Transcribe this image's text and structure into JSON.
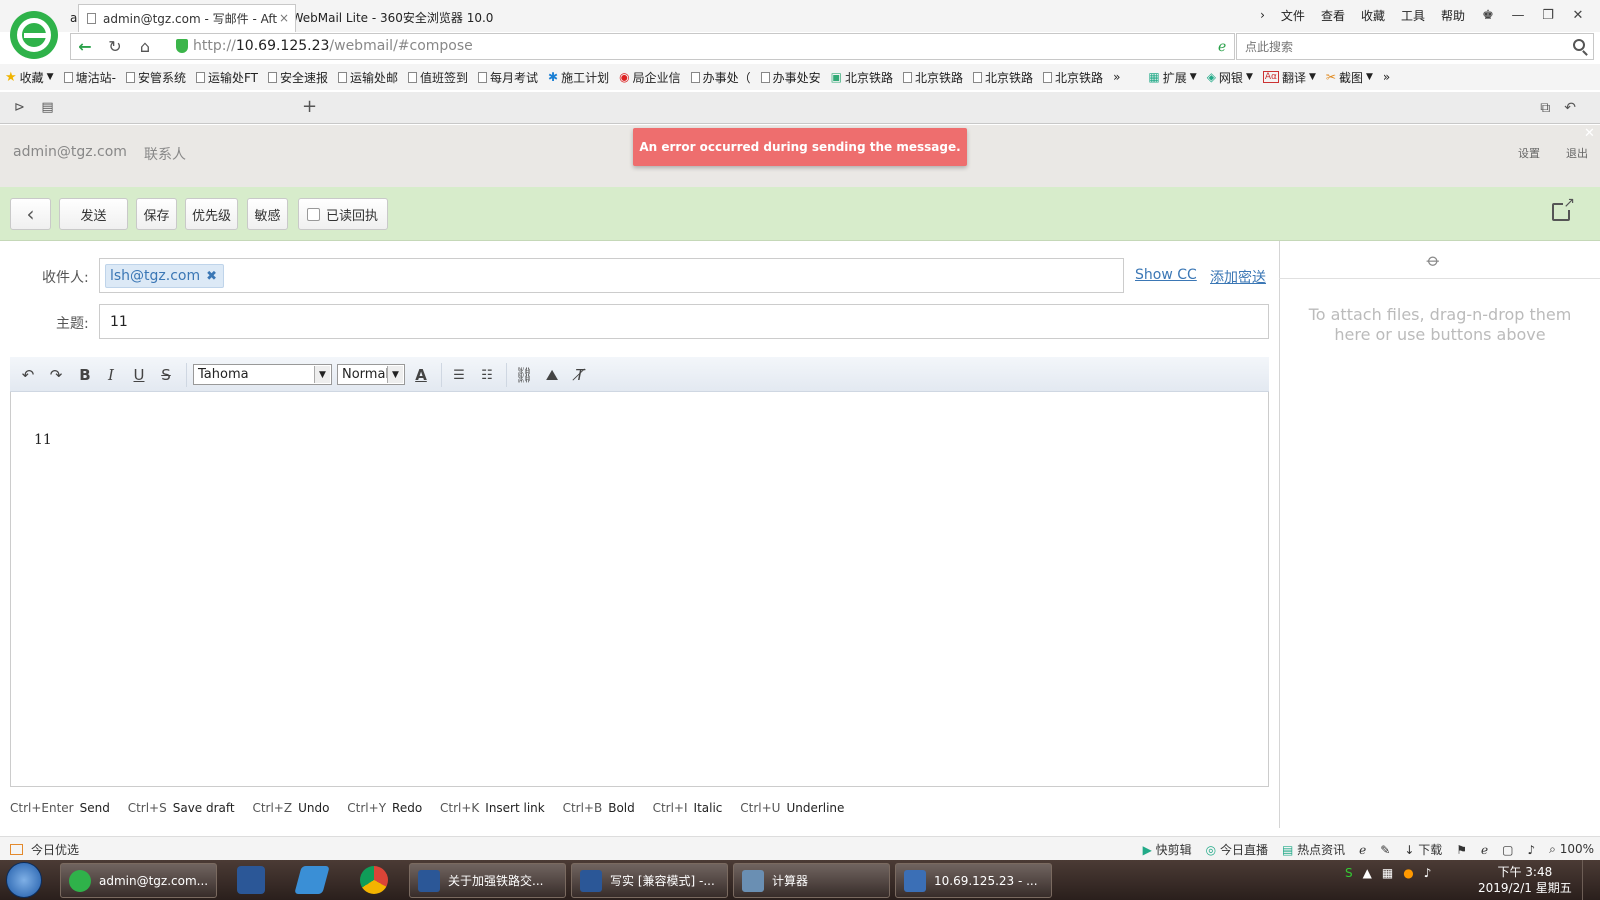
{
  "browser": {
    "window_title": "admin@tgz.com - 写邮件 - AfterLogic WebMail Lite - 360安全浏览器 10.0",
    "menu": [
      "文件",
      "查看",
      "收藏",
      "工具",
      "帮助"
    ],
    "url_scheme": "http://",
    "url_host": "10.69.125.23",
    "url_path": "/webmail/#compose",
    "search_placeholder": "点此搜索",
    "bookmarks": [
      "收藏",
      "塘沽站-",
      "安管系统",
      "运输处FT",
      "安全速报",
      "运输处邮",
      "值班签到",
      "每月考试",
      "施工计划",
      "局企业信",
      "办事处（",
      "办事处安",
      "北京铁路",
      "北京铁路",
      "北京铁路",
      "北京铁路"
    ],
    "bookmarks_right": [
      "扩展",
      "网银",
      "翻译",
      "截图"
    ],
    "tab_title": "admin@tgz.com - 写邮件 - Aft",
    "status_left": "今日优选",
    "status_right": [
      "快剪辑",
      "今日直播",
      "热点资讯",
      "下载",
      "100%"
    ]
  },
  "mail": {
    "account": "admin@tgz.com",
    "contacts": "联系人",
    "settings": "设置",
    "logout": "退出",
    "error": "An error occurred during sending the message."
  },
  "toolbar": {
    "send": "发送",
    "save": "保存",
    "priority": "优先级",
    "sensitivity": "敏感",
    "read_receipt": "已读回执"
  },
  "compose": {
    "to_label": "收件人:",
    "recipient": "lsh@tgz.com",
    "show_cc": "Show CC",
    "add_bcc": "添加密送",
    "subject_label": "主题:",
    "subject": "11",
    "font": "Tahoma",
    "size": "Normal",
    "body": "11",
    "attach_hint": "To attach files, drag-n-drop them here or use buttons above"
  },
  "hints": [
    {
      "key": "Ctrl+Enter",
      "action": "Send"
    },
    {
      "key": "Ctrl+S",
      "action": "Save draft"
    },
    {
      "key": "Ctrl+Z",
      "action": "Undo"
    },
    {
      "key": "Ctrl+Y",
      "action": "Redo"
    },
    {
      "key": "Ctrl+K",
      "action": "Insert link"
    },
    {
      "key": "Ctrl+B",
      "action": "Bold"
    },
    {
      "key": "Ctrl+I",
      "action": "Italic"
    },
    {
      "key": "Ctrl+U",
      "action": "Underline"
    }
  ],
  "taskbar": {
    "items": [
      "admin@tgz.com...",
      "关于加强铁路交...",
      "写实 [兼容模式] -...",
      "计算器",
      "10.69.125.23 - ..."
    ],
    "time": "下午 3:48",
    "date": "2019/2/1 星期五"
  },
  "colors": {
    "toolbar_green": "#d7eccb",
    "error_red": "#ee6e6e",
    "link_blue": "#3b77b5"
  }
}
